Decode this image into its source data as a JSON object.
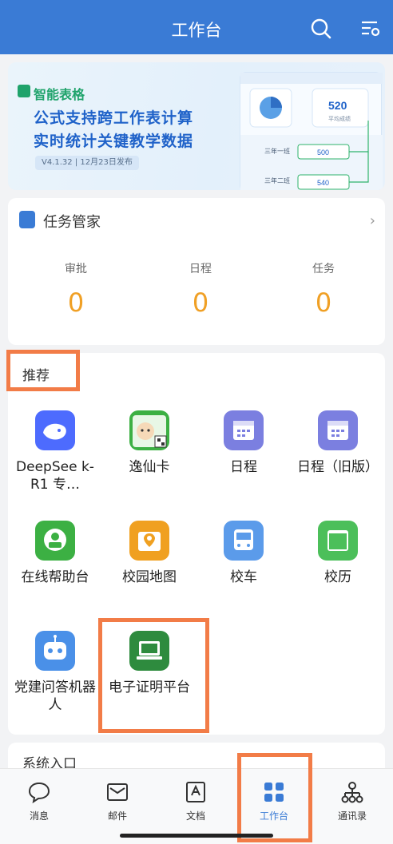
{
  "header": {
    "title": "工作台"
  },
  "banner": {
    "tag": "智能表格",
    "line1": "公式支持跨工作表计算",
    "line2": "实时统计关键教学数据",
    "version": "V4.1.32 | 12月23日发布",
    "panel": {
      "score": "520",
      "score_label": "平均成绩",
      "row1": "三年一班",
      "row1_val": "500",
      "row2": "三年二班",
      "row2_val": "540"
    }
  },
  "task_manager": {
    "title": "任务管家",
    "stats": [
      {
        "label": "审批",
        "value": "0"
      },
      {
        "label": "日程",
        "value": "0"
      },
      {
        "label": "任务",
        "value": "0"
      }
    ]
  },
  "recommend": {
    "title": "推荐",
    "apps": [
      {
        "label": "DeepSee k-R1 专…",
        "icon": "deepseek-whale-icon",
        "color": "#4d6bfe"
      },
      {
        "label": "逸仙卡",
        "icon": "yixian-card-icon",
        "color": "#3cb043"
      },
      {
        "label": "日程",
        "icon": "calendar-icon",
        "color": "#7b7fe0"
      },
      {
        "label": "日程（旧版）",
        "icon": "calendar-icon",
        "color": "#7b7fe0"
      },
      {
        "label": "在线帮助台",
        "icon": "online-help-icon",
        "color": "#3cb043"
      },
      {
        "label": "校园地图",
        "icon": "map-pin-icon",
        "color": "#f0a020"
      },
      {
        "label": "校车",
        "icon": "bus-icon",
        "color": "#5b9bea"
      },
      {
        "label": "校历",
        "icon": "school-calendar-icon",
        "color": "#4cbf5a"
      },
      {
        "label": "党建问答机器人",
        "icon": "robot-icon",
        "color": "#4a90e8"
      },
      {
        "label": "电子证明平台",
        "icon": "certificate-laptop-icon",
        "color": "#2e8b3e"
      }
    ]
  },
  "system": {
    "title": "系统入口"
  },
  "tabbar": [
    {
      "label": "消息",
      "icon": "chat-bubble-icon"
    },
    {
      "label": "邮件",
      "icon": "mail-icon"
    },
    {
      "label": "文档",
      "icon": "document-icon"
    },
    {
      "label": "工作台",
      "icon": "grid-icon",
      "active": true
    },
    {
      "label": "通讯录",
      "icon": "org-chart-icon"
    }
  ]
}
